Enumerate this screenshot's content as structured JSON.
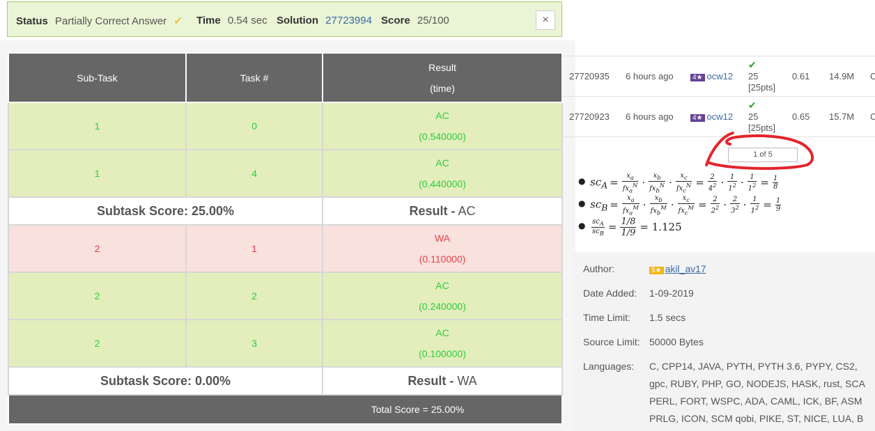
{
  "status_bar": {
    "status_label": "Status",
    "status_value": "Partially Correct Answer",
    "time_label": "Time",
    "time_value": "0.54 sec",
    "solution_label": "Solution",
    "solution_value": "27723994",
    "score_label": "Score",
    "score_value": "25/100",
    "close_icon": "×"
  },
  "results": {
    "headers": {
      "subtask": "Sub-Task",
      "task": "Task #",
      "result": "Result",
      "time": "(time)"
    },
    "rows": [
      {
        "subtask": "1",
        "task": "0",
        "verdict": "AC",
        "time": "(0.540000)"
      },
      {
        "subtask": "1",
        "task": "4",
        "verdict": "AC",
        "time": "(0.440000)"
      },
      {
        "subtask": "2",
        "task": "1",
        "verdict": "WA",
        "time": "(0.110000)"
      },
      {
        "subtask": "2",
        "task": "2",
        "verdict": "AC",
        "time": "(0.240000)"
      },
      {
        "subtask": "2",
        "task": "3",
        "verdict": "AC",
        "time": "(0.100000)"
      }
    ],
    "subtask_scores": [
      {
        "label": "Subtask Score: 25.00%",
        "result_label": "Result -",
        "result_value": "AC"
      },
      {
        "label": "Subtask Score: 0.00%",
        "result_label": "Result -",
        "result_value": "WA"
      }
    ],
    "total": "Total Score = 25.00%"
  },
  "submissions": [
    {
      "id": "27720935",
      "when": "6 hours ago",
      "stars": "4★",
      "user": "ocw12",
      "score": "25",
      "pts": "[25pts]",
      "time": "0.61",
      "mem": "14.9M",
      "lang": "C"
    },
    {
      "id": "27720923",
      "when": "6 hours ago",
      "stars": "4★",
      "user": "ocw12",
      "score": "25",
      "pts": "[25pts]",
      "time": "0.65",
      "mem": "15.7M",
      "lang": "C"
    }
  ],
  "pager": "1 of 5",
  "formulas": {
    "line1": {
      "lhs": "sc",
      "sub": "A",
      "result": "1",
      "result_den": "8"
    },
    "line2": {
      "lhs": "sc",
      "sub": "B",
      "result": "1",
      "result_den": "9"
    },
    "line3": {
      "value": "= 1.125"
    }
  },
  "info": {
    "author_label": "Author:",
    "author_stars": "5★",
    "author_value": "akil_av17",
    "date_label": "Date Added:",
    "date_value": "1-09-2019",
    "time_limit_label": "Time Limit:",
    "time_limit_value": "1.5 secs",
    "source_limit_label": "Source Limit:",
    "source_limit_value": "50000 Bytes",
    "languages_label": "Languages:",
    "languages_lines": [
      "C, CPP14, JAVA, PYTH, PYTH 3.6, PYPY, CS2,",
      "gpc, RUBY, PHP, GO, NODEJS, HASK, rust, SCA",
      "PERL, FORT, WSPC, ADA, CAML, ICK, BF, ASM",
      "PRLG, ICON, SCM qobi, PIKE, ST, NICE, LUA, B"
    ]
  },
  "colors": {
    "ac": "#2ecc40",
    "wa": "#e8414a",
    "link": "#3a6aa5",
    "header": "#666666",
    "ac_bg": "#e3eebc",
    "wa_bg": "#f9e1dd"
  }
}
